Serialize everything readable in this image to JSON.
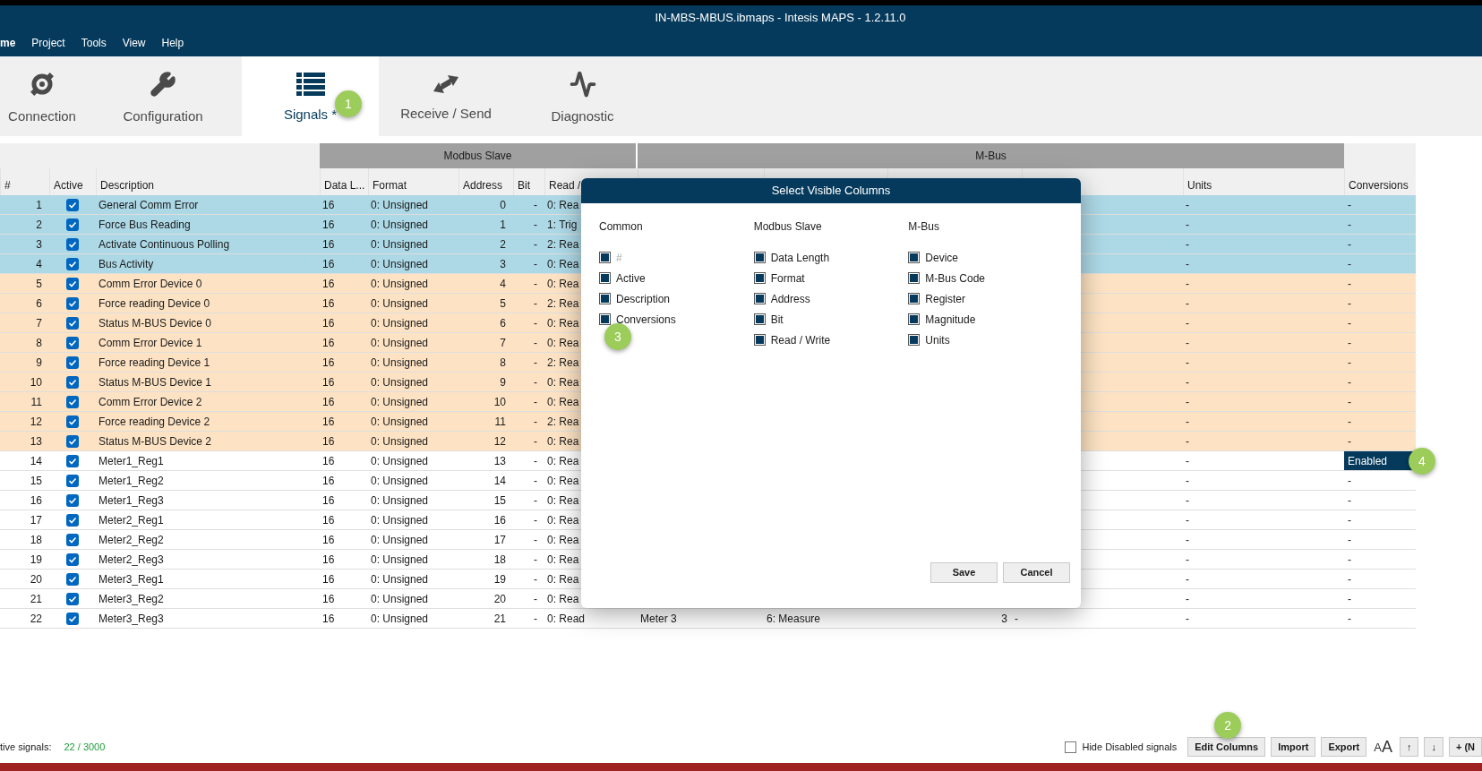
{
  "window": {
    "title": "IN-MBS-MBUS.ibmaps - Intesis MAPS - 1.2.11.0"
  },
  "menu": [
    {
      "label": "me",
      "selected": true
    },
    {
      "label": "Project",
      "selected": false
    },
    {
      "label": "Tools",
      "selected": false
    },
    {
      "label": "View",
      "selected": false
    },
    {
      "label": "Help",
      "selected": false
    }
  ],
  "tabs": [
    {
      "label": "Connection",
      "selected": false
    },
    {
      "label": "Configuration",
      "selected": false
    },
    {
      "label": "Signals *",
      "selected": true,
      "badge": "1"
    },
    {
      "label": "Receive / Send",
      "selected": false
    },
    {
      "label": "Diagnostic",
      "selected": false
    }
  ],
  "table": {
    "groups": [
      "Modbus Slave",
      "M-Bus"
    ],
    "columns": [
      "#",
      "Active",
      "Description",
      "Data L...",
      "Format",
      "Address",
      "Bit",
      "Read /",
      "Units",
      "Conversions"
    ],
    "rows": [
      {
        "number": "1",
        "active": true,
        "description": "General Comm Error",
        "data_length": "16",
        "format": "0: Unsigned",
        "address": "0",
        "bit": "-",
        "read_write": "0: Rea",
        "units": "-",
        "conversions": "-",
        "conversions_selected": false,
        "color": "#add8e6"
      },
      {
        "number": "2",
        "active": true,
        "description": "Force Bus Reading",
        "data_length": "16",
        "format": "0: Unsigned",
        "address": "1",
        "bit": "-",
        "read_write": "1: Trig",
        "units": "-",
        "conversions": "-",
        "color": "#add8e6"
      },
      {
        "number": "3",
        "active": true,
        "description": "Activate Continuous Polling",
        "data_length": "16",
        "format": "0: Unsigned",
        "address": "2",
        "bit": "-",
        "read_write": "2: Rea",
        "units": "-",
        "conversions": "-",
        "color": "#add8e6"
      },
      {
        "number": "4",
        "active": true,
        "description": "Bus Activity",
        "data_length": "16",
        "format": "0: Unsigned",
        "address": "3",
        "bit": "-",
        "read_write": "0: Rea",
        "units": "-",
        "conversions": "-",
        "color": "#add8e6"
      },
      {
        "number": "5",
        "active": true,
        "description": "Comm Error Device 0",
        "data_length": "16",
        "format": "0: Unsigned",
        "address": "4",
        "bit": "-",
        "read_write": "0: Rea",
        "units": "-",
        "conversions": "-",
        "color": "#fde3c4"
      },
      {
        "number": "6",
        "active": true,
        "description": "Force reading Device 0",
        "data_length": "16",
        "format": "0: Unsigned",
        "address": "5",
        "bit": "-",
        "read_write": "2: Rea",
        "units": "-",
        "conversions": "-",
        "color": "#fde3c4"
      },
      {
        "number": "7",
        "active": true,
        "description": "Status M-BUS Device 0",
        "data_length": "16",
        "format": "0: Unsigned",
        "address": "6",
        "bit": "-",
        "read_write": "0: Rea",
        "units": "-",
        "conversions": "-",
        "color": "#fde3c4"
      },
      {
        "number": "8",
        "active": true,
        "description": "Comm Error Device 1",
        "data_length": "16",
        "format": "0: Unsigned",
        "address": "7",
        "bit": "-",
        "read_write": "0: Rea",
        "units": "-",
        "conversions": "-",
        "color": "#fde3c4"
      },
      {
        "number": "9",
        "active": true,
        "description": "Force reading Device 1",
        "data_length": "16",
        "format": "0: Unsigned",
        "address": "8",
        "bit": "-",
        "read_write": "2: Rea",
        "units": "-",
        "conversions": "-",
        "color": "#fde3c4"
      },
      {
        "number": "10",
        "active": true,
        "description": "Status M-BUS Device 1",
        "data_length": "16",
        "format": "0: Unsigned",
        "address": "9",
        "bit": "-",
        "read_write": "0: Rea",
        "units": "-",
        "conversions": "-",
        "color": "#fde3c4"
      },
      {
        "number": "11",
        "active": true,
        "description": "Comm Error Device 2",
        "data_length": "16",
        "format": "0: Unsigned",
        "address": "10",
        "bit": "-",
        "read_write": "0: Rea",
        "units": "-",
        "conversions": "-",
        "color": "#fde3c4"
      },
      {
        "number": "12",
        "active": true,
        "description": "Force reading Device 2",
        "data_length": "16",
        "format": "0: Unsigned",
        "address": "11",
        "bit": "-",
        "read_write": "2: Rea",
        "units": "-",
        "conversions": "-",
        "color": "#fde3c4"
      },
      {
        "number": "13",
        "active": true,
        "description": "Status M-BUS Device 2",
        "data_length": "16",
        "format": "0: Unsigned",
        "address": "12",
        "bit": "-",
        "read_write": "0: Rea",
        "units": "-",
        "conversions": "-",
        "color": "#fde3c4"
      },
      {
        "number": "14",
        "active": true,
        "description": "Meter1_Reg1",
        "data_length": "16",
        "format": "0: Unsigned",
        "address": "13",
        "bit": "-",
        "read_write": "0: Rea",
        "units": "-",
        "conversions": "Enabled",
        "conversions_selected": true,
        "badge": "4",
        "color": "#ffffff"
      },
      {
        "number": "15",
        "active": true,
        "description": "Meter1_Reg2",
        "data_length": "16",
        "format": "0: Unsigned",
        "address": "14",
        "bit": "-",
        "read_write": "0: Rea",
        "units": "-",
        "conversions": "-",
        "color": "#ffffff"
      },
      {
        "number": "16",
        "active": true,
        "description": "Meter1_Reg3",
        "data_length": "16",
        "format": "0: Unsigned",
        "address": "15",
        "bit": "-",
        "read_write": "0: Rea",
        "units": "-",
        "conversions": "-",
        "color": "#ffffff"
      },
      {
        "number": "17",
        "active": true,
        "description": "Meter2_Reg1",
        "data_length": "16",
        "format": "0: Unsigned",
        "address": "16",
        "bit": "-",
        "read_write": "0: Rea",
        "units": "-",
        "conversions": "-",
        "color": "#ffffff"
      },
      {
        "number": "18",
        "active": true,
        "description": "Meter2_Reg2",
        "data_length": "16",
        "format": "0: Unsigned",
        "address": "17",
        "bit": "-",
        "read_write": "0: Rea",
        "units": "-",
        "conversions": "-",
        "color": "#ffffff"
      },
      {
        "number": "19",
        "active": true,
        "description": "Meter2_Reg3",
        "data_length": "16",
        "format": "0: Unsigned",
        "address": "18",
        "bit": "-",
        "read_write": "0: Rea",
        "units": "-",
        "conversions": "-",
        "color": "#ffffff"
      },
      {
        "number": "20",
        "active": true,
        "description": "Meter3_Reg1",
        "data_length": "16",
        "format": "0: Unsigned",
        "address": "19",
        "bit": "-",
        "read_write": "0: Rea",
        "units": "-",
        "conversions": "-",
        "color": "#ffffff"
      },
      {
        "number": "21",
        "active": true,
        "description": "Meter3_Reg2",
        "data_length": "16",
        "format": "0: Unsigned",
        "address": "20",
        "bit": "-",
        "read_write": "0: Rea",
        "units": "-",
        "conversions": "-",
        "color": "#ffffff"
      },
      {
        "number": "22",
        "active": true,
        "description": "Meter3_Reg3",
        "data_length": "16",
        "format": "0: Unsigned",
        "address": "21",
        "bit": "-",
        "read_write": "0: Read",
        "device": "Meter 3",
        "mbus_code": "6: Measure",
        "register": "3",
        "magnitude": "-",
        "units": "-",
        "conversions": "-",
        "color": "#ffffff"
      }
    ]
  },
  "dialog": {
    "title": "Select Visible Columns",
    "groups": [
      {
        "title": "Common",
        "items": [
          {
            "label": "#",
            "checked": true,
            "disabled": true
          },
          {
            "label": "Active",
            "checked": true,
            "disabled": false
          },
          {
            "label": "Description",
            "checked": true,
            "disabled": false
          },
          {
            "label": "Conversions",
            "checked": true,
            "disabled": false,
            "badge": "3"
          }
        ]
      },
      {
        "title": "Modbus Slave",
        "items": [
          {
            "label": "Data Length",
            "checked": true,
            "disabled": false
          },
          {
            "label": "Format",
            "checked": true,
            "disabled": false
          },
          {
            "label": "Address",
            "checked": true,
            "disabled": false
          },
          {
            "label": "Bit",
            "checked": true,
            "disabled": false
          },
          {
            "label": "Read / Write",
            "checked": true,
            "disabled": false
          }
        ]
      },
      {
        "title": "M-Bus",
        "items": [
          {
            "label": "Device",
            "checked": true,
            "disabled": false
          },
          {
            "label": "M-Bus Code",
            "checked": true,
            "disabled": false
          },
          {
            "label": "Register",
            "checked": true,
            "disabled": false
          },
          {
            "label": "Magnitude",
            "checked": true,
            "disabled": false
          },
          {
            "label": "Units",
            "checked": true,
            "disabled": false
          }
        ]
      }
    ],
    "buttons": [
      "Save",
      "Cancel"
    ]
  },
  "status_bar": {
    "label": "tive signals:",
    "value": "22 / 3000",
    "hide_disabled": {
      "label": "Hide Disabled signals",
      "checked": false
    },
    "buttons": [
      {
        "kind": "text",
        "label": "Edit Columns",
        "badge": "2"
      },
      {
        "kind": "text",
        "label": "Import"
      },
      {
        "kind": "text",
        "label": "Export"
      },
      {
        "kind": "font",
        "small": "A",
        "large": "A"
      },
      {
        "kind": "text",
        "label": "↑"
      },
      {
        "kind": "text",
        "label": "↓"
      },
      {
        "kind": "text",
        "label": "+ (N"
      }
    ]
  }
}
